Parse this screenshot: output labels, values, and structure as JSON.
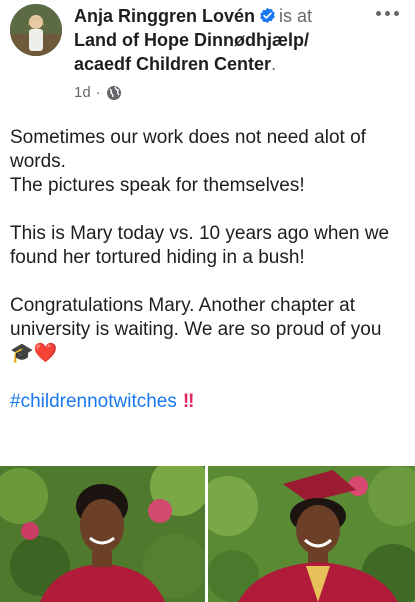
{
  "post": {
    "author": "Anja Ringgren Lovén",
    "is_at": "is at",
    "place": "Land of Hope Dinnødhjælp/ acaedf Children Center",
    "place_suffix": ".",
    "time": "1d",
    "privacy_icon": "globe-icon",
    "verified_icon": "verified-badge-icon",
    "more_icon": "more-options-icon",
    "line1": "Sometimes our work does not need alot of words.",
    "line2": "The pictures speak for themselves!",
    "line3": "This is Mary today vs. 10 years ago when we found her tortured hiding in a bush!",
    "line4": "Congratulations Mary. Another chapter at university is waiting. We are so proud of you",
    "line4_emoji": "🎓❤️",
    "hashtag": "#childrennotwitches",
    "hashtag_suffix": "‼",
    "colors": {
      "link": "#1877f2",
      "text": "#1c1e21",
      "secondary": "#65676b",
      "gown": "#b01b3a"
    }
  },
  "photos": [
    {
      "name": "photo-mary-then"
    },
    {
      "name": "photo-mary-graduation"
    }
  ]
}
